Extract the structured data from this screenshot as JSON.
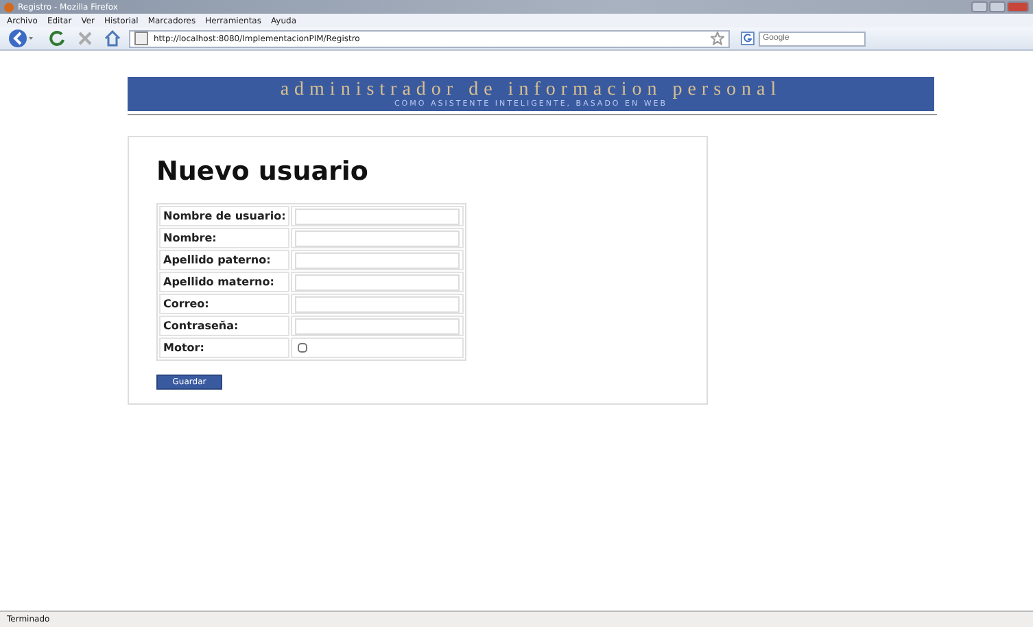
{
  "window": {
    "title": "Registro - Mozilla Firefox"
  },
  "menu": [
    "Archivo",
    "Editar",
    "Ver",
    "Historial",
    "Marcadores",
    "Herramientas",
    "Ayuda"
  ],
  "address": {
    "value": "http://localhost:8080/ImplementacionPIM/Registro"
  },
  "search": {
    "placeholder": "Google"
  },
  "banner": {
    "title": "administrador de informacion personal",
    "subtitle": "COMO ASISTENTE INTELIGENTE, BASADO EN WEB"
  },
  "form": {
    "heading": "Nuevo usuario",
    "fields": [
      {
        "label": "Nombre de usuario:",
        "kind": "text"
      },
      {
        "label": "Nombre:",
        "kind": "text"
      },
      {
        "label": "Apellido paterno:",
        "kind": "text"
      },
      {
        "label": "Apellido materno:",
        "kind": "text"
      },
      {
        "label": "Correo:",
        "kind": "text"
      },
      {
        "label": "Contraseña:",
        "kind": "text"
      },
      {
        "label": "Motor:",
        "kind": "checkbox",
        "checked": false
      }
    ],
    "button": "Guardar"
  },
  "status_bar": "Terminado"
}
